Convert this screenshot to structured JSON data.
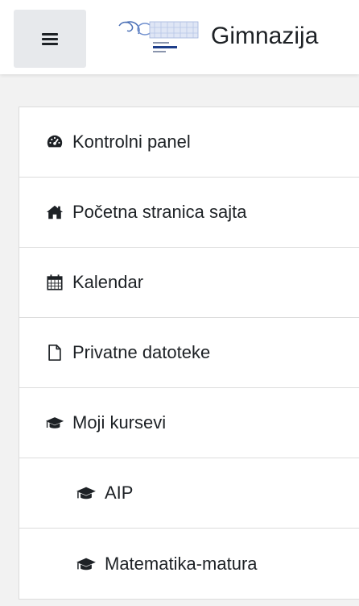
{
  "header": {
    "menu_icon": "hamburger-icon",
    "site_name": "Gimnazija",
    "logo_icon": "school-logo"
  },
  "nav": {
    "items": [
      {
        "label": "Kontrolni panel",
        "icon": "dashboard-icon",
        "level": 1
      },
      {
        "label": "Početna stranica sajta",
        "icon": "home-icon",
        "level": 1
      },
      {
        "label": "Kalendar",
        "icon": "calendar-icon",
        "level": 1
      },
      {
        "label": "Privatne datoteke",
        "icon": "file-icon",
        "level": 1
      },
      {
        "label": "Moji kursevi",
        "icon": "graduation-cap-icon",
        "level": 1
      },
      {
        "label": "AIP",
        "icon": "graduation-cap-icon",
        "level": 2
      },
      {
        "label": "Matematika-matura",
        "icon": "graduation-cap-icon",
        "level": 2
      }
    ]
  },
  "colors": {
    "text": "#1d2125",
    "border": "#dcdcdc",
    "button_bg": "#e7e9ec",
    "page_bg": "#f2f2f2"
  }
}
